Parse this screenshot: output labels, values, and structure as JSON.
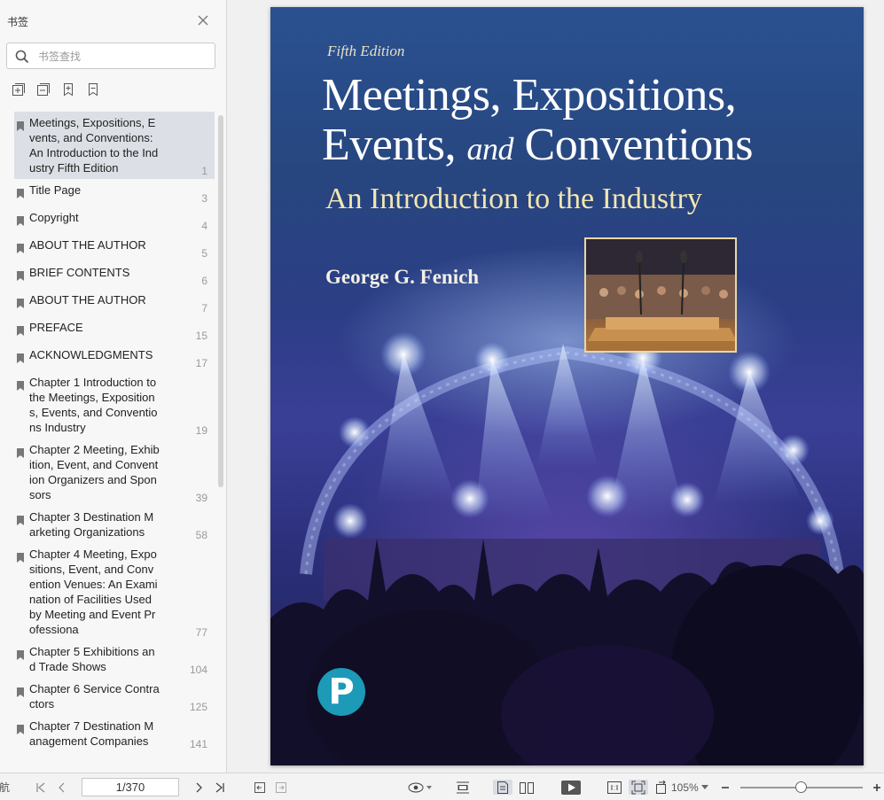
{
  "sidebar": {
    "title": "书签",
    "search_placeholder": "书签查找",
    "items": [
      {
        "label": "Meetings, Expositions, Events, and Conventions: An Introduction to the Industry Fifth Edition",
        "page": "1",
        "selected": true
      },
      {
        "label": "Title Page",
        "page": "3"
      },
      {
        "label": "Copyright",
        "page": "4"
      },
      {
        "label": "ABOUT THE AUTHOR",
        "page": "5"
      },
      {
        "label": "BRIEF CONTENTS",
        "page": "6"
      },
      {
        "label": "ABOUT THE AUTHOR",
        "page": "7"
      },
      {
        "label": "PREFACE",
        "page": "15"
      },
      {
        "label": "ACKNOWLEDGMENTS",
        "page": "17"
      },
      {
        "label": "Chapter 1 Introduction to the Meetings, Expositions, Events, and Conventions Industry",
        "page": "19"
      },
      {
        "label": "Chapter 2 Meeting, Exhibition, Event, and Convention Organizers and Sponsors",
        "page": "39"
      },
      {
        "label": "Chapter 3 Destination Marketing Organizations",
        "page": "58"
      },
      {
        "label": "Chapter 4 Meeting, Expositions, Event, and Convention Venues: An Examination of Facilities Used by Meeting and Event Professiona",
        "page": "77"
      },
      {
        "label": "Chapter 5 Exhibitions and Trade Shows",
        "page": "104"
      },
      {
        "label": "Chapter 6 Service Contractors",
        "page": "125"
      },
      {
        "label": "Chapter 7 Destination Management Companies",
        "page": "141"
      }
    ]
  },
  "cover": {
    "edition": "Fifth Edition",
    "title_line1": "Meetings, Expositions,",
    "title_line2_a": "Events, ",
    "title_line2_and": "and",
    "title_line2_b": " Conventions",
    "subtitle": "An Introduction to the Industry",
    "author": "George G. Fenich",
    "publisher_logo_letter": "P"
  },
  "toolbar": {
    "page_value": "1/370",
    "zoom": "105%",
    "left_cut_label": "航"
  }
}
